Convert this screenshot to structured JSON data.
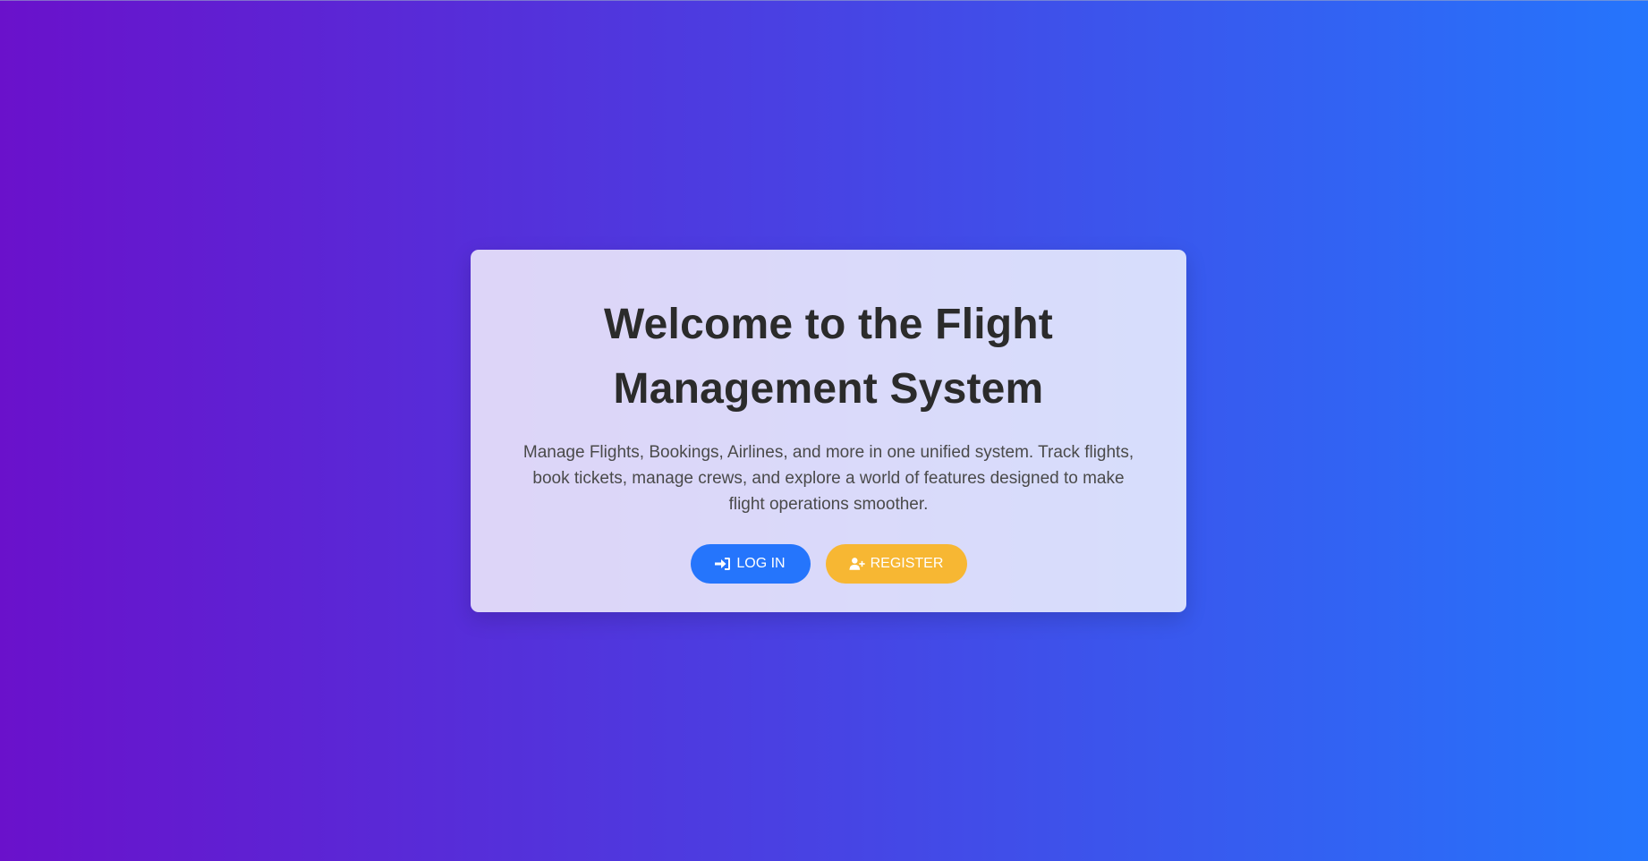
{
  "hero": {
    "title": "Welcome to the Flight Management System",
    "description": "Manage Flights, Bookings, Airlines, and more in one unified system. Track flights, book tickets, manage crews, and explore a world of features designed to make flight operations smoother."
  },
  "actions": {
    "login_label": "LOG IN",
    "login_icon": "sign-in-icon",
    "register_label": "REGISTER",
    "register_icon": "user-plus-icon"
  },
  "colors": {
    "gradient_start": "#6a11cb",
    "gradient_end": "#2575fc",
    "login_button": "#2575fc",
    "register_button": "#f7b733"
  }
}
